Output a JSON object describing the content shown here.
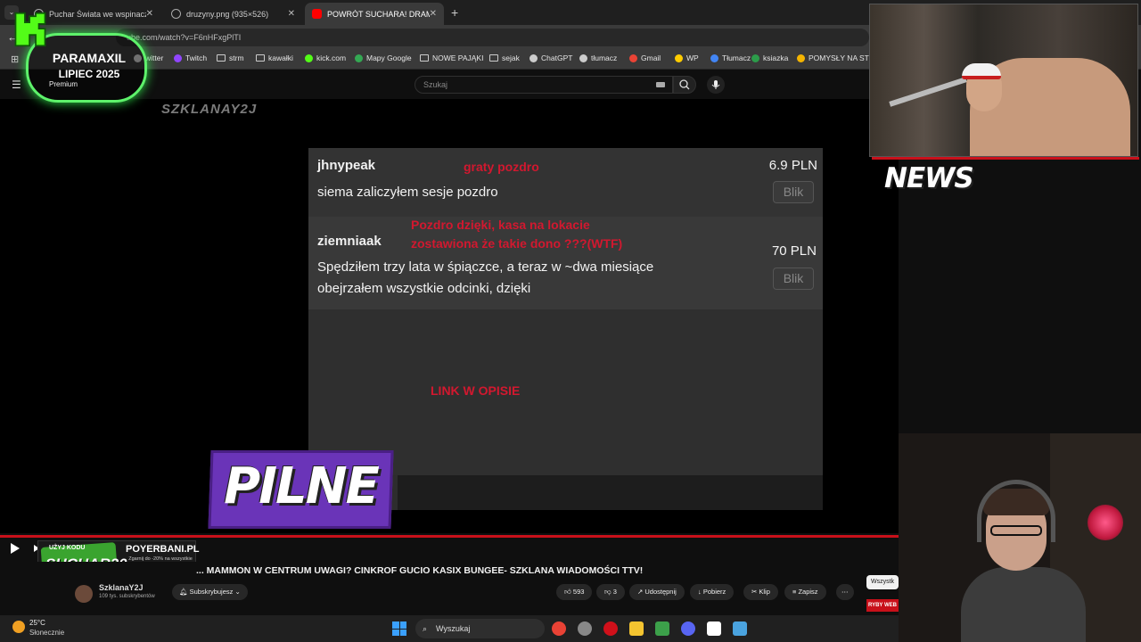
{
  "browser": {
    "tabs": [
      {
        "label": "Puchar Świata we wspinaczce w"
      },
      {
        "label": "druzyny.png (935×526)"
      },
      {
        "label": "POWRÓT SUCHARA! DRAMA..."
      }
    ],
    "new_tab_symbol": "+",
    "url": "ube.com/watch?v=F6nHFxgPlTI",
    "bookmarks": [
      {
        "label": "witter",
        "icon": "twitter-icon"
      },
      {
        "label": "Twitch",
        "icon": "twitch-icon",
        "color": "#9146ff"
      },
      {
        "label": "strm",
        "icon": "folder-icon"
      },
      {
        "label": "kawałki",
        "icon": "folder-icon"
      },
      {
        "label": "kick.com",
        "icon": "kick-icon",
        "color": "#53fc18"
      },
      {
        "label": "Mapy Google",
        "icon": "maps-icon",
        "color": "#34a853"
      },
      {
        "label": "NOWE PAJĄKI",
        "icon": "folder-icon"
      },
      {
        "label": "sejak",
        "icon": "folder-icon"
      },
      {
        "label": "ChatGPT",
        "icon": "chatgpt-icon"
      },
      {
        "label": "tłumacz",
        "icon": "globe-icon"
      },
      {
        "label": "Gmail",
        "icon": "gmail-icon",
        "color": "#ea4335"
      },
      {
        "label": "WP",
        "icon": "wp-icon",
        "color": "#ffcc00"
      },
      {
        "label": "Tłumacz",
        "icon": "translate-icon",
        "color": "#4285f4"
      },
      {
        "label": "ksiazka",
        "icon": "book-icon",
        "color": "#2c9c4a"
      },
      {
        "label": "POMYSŁY NA STRE",
        "icon": "sheets-icon",
        "color": "#f4b400"
      }
    ]
  },
  "youtube": {
    "search_placeholder": "Szukaj",
    "premium_label": "Premium",
    "video_title": "... MAMMON W CENTRUM UWAGI? CINKROF GUCIO KASIX BUNGEE- SZKLANA WIADOMOŚCI TTV!",
    "channel": {
      "name": "SzklanaY2J",
      "subs": "109 tys. subskrybentów",
      "subscribe_label": "Subskrybujesz"
    },
    "actions": {
      "likes": "593",
      "dislikes": "3",
      "share": "Udostępnij",
      "download": "Pobierz",
      "clip": "Klip",
      "save": "Zapisz",
      "more": "⋯"
    },
    "chip": "Wszystk"
  },
  "video": {
    "watermark": "SZKLANAY2J",
    "donations": [
      {
        "name": "jhnypeak",
        "amount": "6.9 PLN",
        "message": "siema zaliczyłem sesje pozdro",
        "button": "Blik",
        "note": "graty pozdro"
      },
      {
        "name": "ziemniaak",
        "amount": "70 PLN",
        "message_lines": [
          "Spędziłem trzy lata w śpiączce, a teraz w ~dwa miesiące",
          "obejrzałem wszystkie odcinki, dzięki"
        ],
        "button": "Blik",
        "note_lines": [
          "Pozdro dzięki, kasa na lokacie",
          "zostawiona że takie dono ???(WTF)"
        ]
      }
    ],
    "link_note": "LINK W OPISIE",
    "pilne": "PILNE",
    "promo": {
      "top": "UŻYJ KODU",
      "code": "SUCHAR20",
      "brand": "POYERBANI.PL",
      "desc": "Zgarnij do -20% na wszystkie produkty od Poyerbani z kodem Twórcy"
    }
  },
  "overlays": {
    "badge_line1": "PARAMAXIL",
    "badge_line2": "LIPIEC 2025",
    "news": "NEWS",
    "ryby": "RYBY WEB"
  },
  "taskbar": {
    "temp": "25°C",
    "weather": "Słonecznie",
    "search": "Wyszukaj",
    "apps": [
      {
        "icon": "chrome-icon",
        "color": "#e94235"
      },
      {
        "icon": "settings-icon",
        "color": "#888888"
      },
      {
        "icon": "opera-icon",
        "color": "#d0101a"
      },
      {
        "icon": "folder-icon",
        "color": "#f4c430"
      },
      {
        "icon": "shield-icon",
        "color": "#3ca04a"
      },
      {
        "icon": "discord-icon",
        "color": "#5865f2"
      },
      {
        "icon": "capcut-icon",
        "color": "#ffffff"
      },
      {
        "icon": "notepad-icon",
        "color": "#4aa3df"
      }
    ]
  }
}
